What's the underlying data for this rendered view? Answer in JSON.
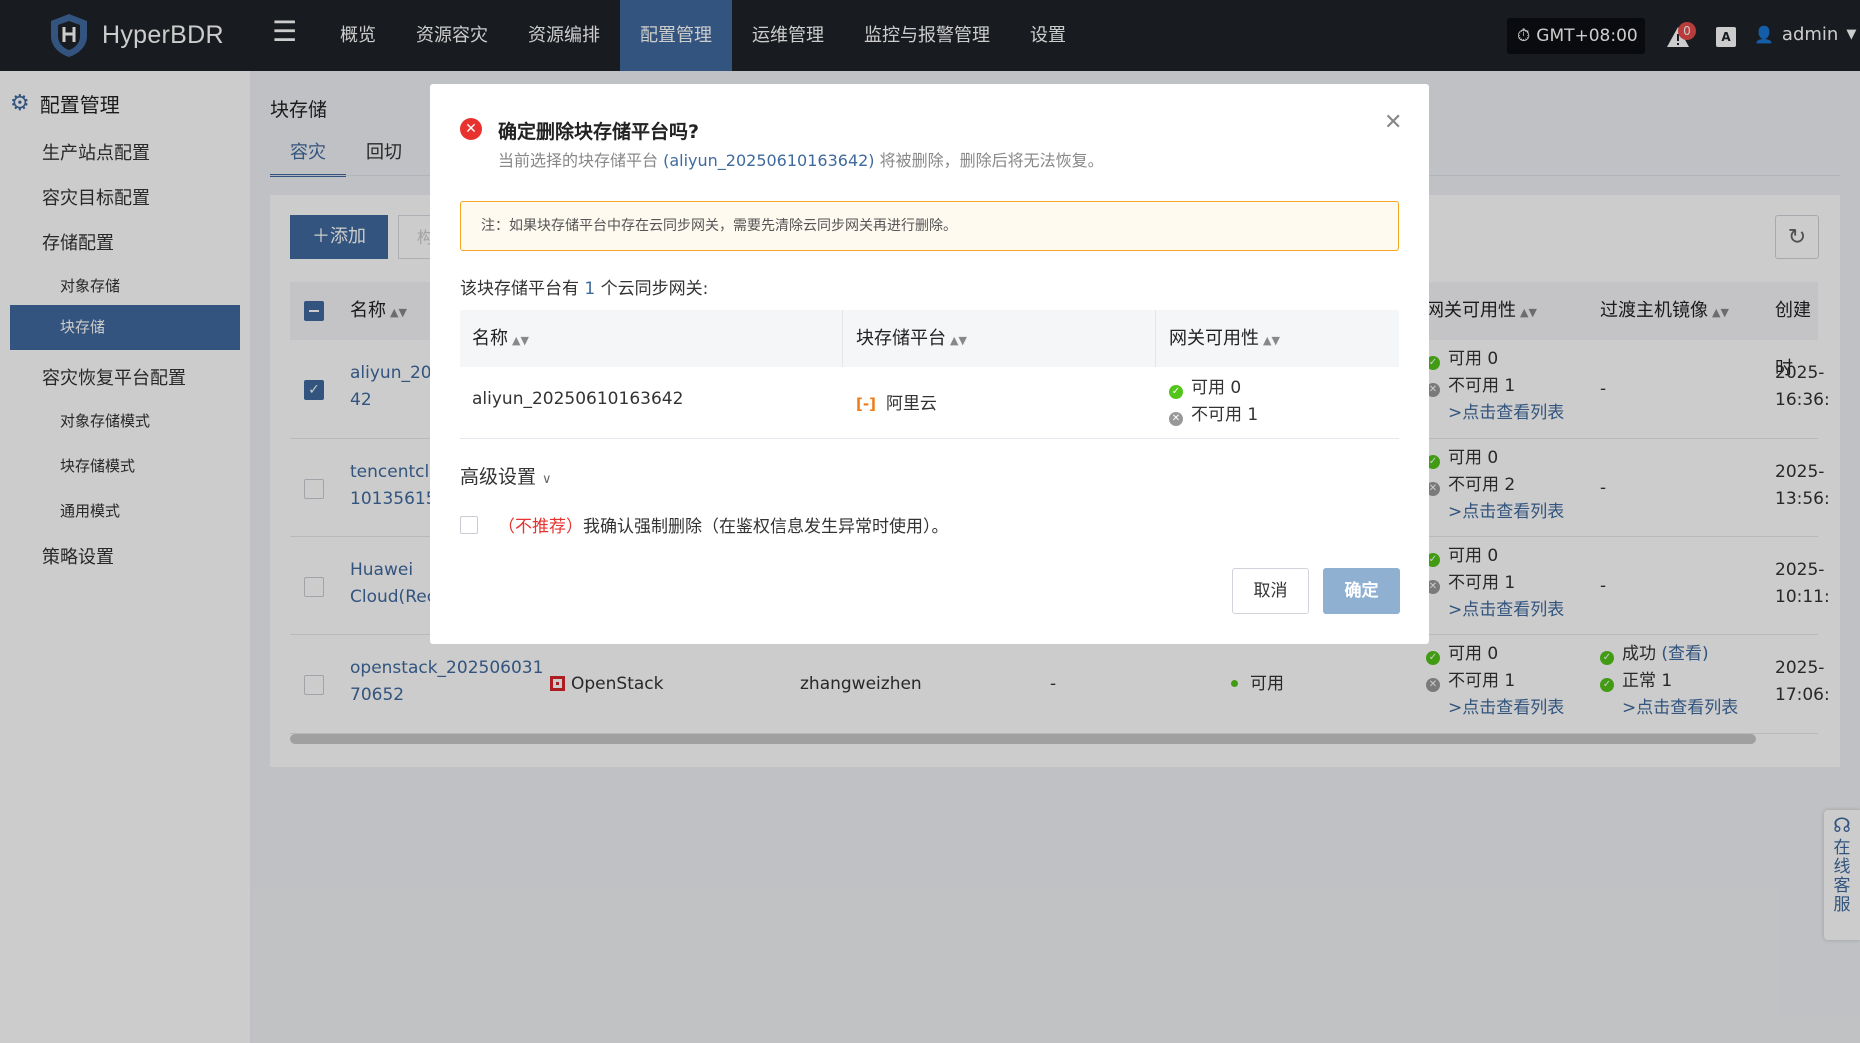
{
  "topbar": {
    "app_name": "HyperBDR",
    "nav": [
      "概览",
      "资源容灾",
      "资源编排",
      "配置管理",
      "运维管理",
      "监控与报警管理",
      "设置"
    ],
    "timezone": "GMT+08:00",
    "alert_count": "0",
    "lang_label": "A",
    "user": "admin"
  },
  "sidebar": {
    "header": "配置管理",
    "items": {
      "prod": "生产站点配置",
      "dr_target": "容灾目标配置",
      "storage": "存储配置",
      "object_storage": "对象存储",
      "block_storage": "块存储",
      "dr_platform": "容灾恢复平台配置",
      "object_mode": "对象存储模式",
      "block_mode": "块存储模式",
      "general_mode": "通用模式",
      "policy": "策略设置"
    }
  },
  "page": {
    "title": "块存储",
    "tabs": [
      "容灾",
      "回切"
    ],
    "add_label": "添加",
    "ghost_label": "构"
  },
  "table": {
    "headers": {
      "name": "名称",
      "gw": "网关可用性",
      "mirror": "过渡主机镜像",
      "created": "创建时"
    },
    "rows": [
      {
        "name_1": "aliyun_202",
        "name_2": "42",
        "gw_ok": "可用 0",
        "gw_no": "不可用 1",
        "gw_link": ">点击查看列表",
        "mirror": "-",
        "time_1": "2025-",
        "time_2": "16:36:"
      },
      {
        "name_1": "tencentclo",
        "name_2": "10135615",
        "gw_ok": "可用 0",
        "gw_no": "不可用 2",
        "gw_link": ">点击查看列表",
        "mirror": "-",
        "time_1": "2025-",
        "time_2": "13:56:"
      },
      {
        "name_1": "Huawei",
        "name_2": "Cloud(Rec",
        "gw_ok": "可用 0",
        "gw_no": "不可用 1",
        "gw_link": ">点击查看列表",
        "mirror": "-",
        "time_1": "2025-",
        "time_2": "10:11:"
      },
      {
        "name_1": "openstack_202506031",
        "name_2": "70652",
        "platform": "OpenStack",
        "user": "zhangweizhen",
        "dash": "-",
        "status": "可用",
        "gw_ok": "可用 0",
        "gw_no": "不可用 1",
        "gw_link": ">点击查看列表",
        "mirror_ok": "成功",
        "mirror_view": "(查看)",
        "mirror_normal": "正常 1",
        "mirror_link": ">点击查看列表",
        "time_1": "2025-",
        "time_2": "17:06:"
      }
    ]
  },
  "helpdesk": [
    "在",
    "线",
    "客",
    "服"
  ],
  "dialog": {
    "title": "确定删除块存储平台吗?",
    "sub_prefix": "当前选择的块存储平台 ",
    "sub_name": "(aliyun_20250610163642)",
    "sub_suffix": " 将被删除，删除后将无法恢复。",
    "notice": "注：如果块存储平台中存在云同步网关，需要先清除云同步网关再进行删除。",
    "gw_prefix": "该块存储平台有 ",
    "gw_num": "1",
    "gw_suffix": " 个云同步网关:",
    "gw_headers": [
      "名称",
      "块存储平台",
      "网关可用性"
    ],
    "gw_row": {
      "name": "aliyun_20250610163642",
      "platform": "阿里云",
      "ok": "可用 0",
      "no": "不可用 1"
    },
    "advanced": "高级设置",
    "force_red": "（不推荐）",
    "force_text": "我确认强制删除（在鉴权信息发生异常时使用）。",
    "cancel": "取消",
    "ok": "确定"
  },
  "colors": {
    "primary": "#3f6a9e",
    "nav_bg": "#1f2229",
    "danger": "#e8322f",
    "success": "#52c41a",
    "warning_border": "#f5a623"
  }
}
